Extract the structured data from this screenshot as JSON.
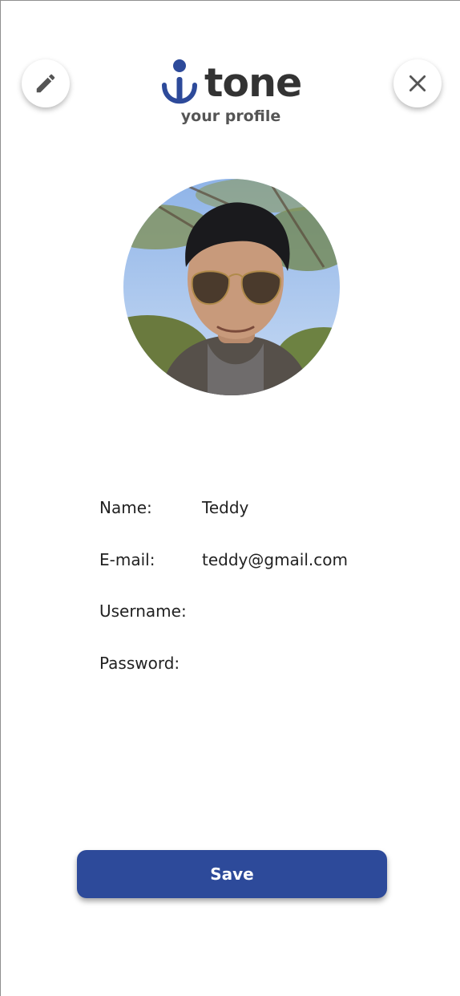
{
  "header": {
    "logo_text": "tone",
    "subtitle": "your profile",
    "edit_icon": "pencil-icon",
    "close_icon": "close-icon"
  },
  "profile": {
    "photo": "profile-photo"
  },
  "fields": [
    {
      "label": "Name:",
      "value": "Teddy"
    },
    {
      "label": "E-mail:",
      "value": "teddy@gmail.com"
    },
    {
      "label": "Username:",
      "value": ""
    },
    {
      "label": "Password:",
      "value": ""
    }
  ],
  "actions": {
    "save_label": "Save"
  },
  "colors": {
    "brand_blue": "#2d4a9a",
    "logo_text": "#333333",
    "icon_gray": "#555555"
  }
}
